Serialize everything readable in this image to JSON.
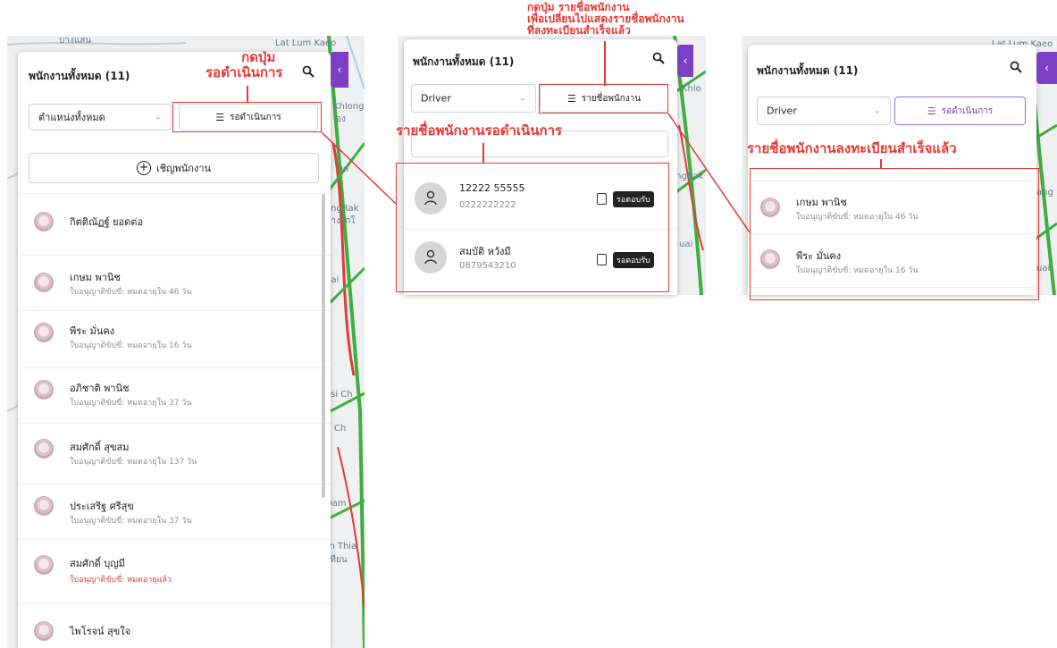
{
  "panels": {
    "left": {
      "title": "พนักงานทั้งหมด (11)",
      "position_select": "ตำแหน่งทั้งหมด",
      "pending_button": "รอดำเนินการ",
      "invite_button": "เชิญพนักงาน",
      "employees": [
        {
          "name": "กิตติณัฏฐ์ ยอดต่อ",
          "sub": "",
          "expired": false
        },
        {
          "name": "เกษม พานิช",
          "sub": "ใบอนุญาติขับขี่: หมดอายุใน 46 วัน",
          "expired": false
        },
        {
          "name": "พีระ มั่นคง",
          "sub": "ใบอนุญาติขับขี่: หมดอายุใน 16 วัน",
          "expired": false
        },
        {
          "name": "อภิชาติ พานิช",
          "sub": "ใบอนุญาติขับขี่: หมดอายุใน 37 วัน",
          "expired": false
        },
        {
          "name": "สมศักดิ์ สุขสม",
          "sub": "ใบอนุญาติขับขี่: หมดอายุใน 137 วัน",
          "expired": false
        },
        {
          "name": "ประเสริฐ ศรีสุข",
          "sub": "ใบอนุญาติขับขี่: หมดอายุใน 37 วัน",
          "expired": false
        },
        {
          "name": "สมศักดิ์ บุญมี",
          "sub": "ใบอนุญาติขับขี่: หมดอายุแล้ว",
          "expired": true
        },
        {
          "name": "ไพโรจน์ สุขใจ",
          "sub": "",
          "expired": false
        }
      ]
    },
    "middle": {
      "title": "พนักงานทั้งหมด (11)",
      "position_select": "Driver",
      "list_button": "รายชื่อพนักงาน",
      "pending": [
        {
          "name": "12222 55555",
          "phone": "0222222222",
          "badge": "รอตอบรับ"
        },
        {
          "name": "สมบัติ หวังมี",
          "phone": "0879543210",
          "badge": "รอตอบรับ"
        }
      ]
    },
    "right": {
      "title": "พนักงานทั้งหมด (11)",
      "position_select": "Driver",
      "pending_button": "รอดำเนินการ",
      "employees": [
        {
          "name": "เกษม พานิช",
          "sub": "ใบอนุญาติขับขี่: หมดอายุใน 46 วัน"
        },
        {
          "name": "พีระ มั่นคง",
          "sub": "ใบอนุญาติขับขี่: หมดอายุใน 16 วัน"
        }
      ]
    }
  },
  "annotations": {
    "a1_line1": "กดปุ่ม",
    "a1_line2": "รอดำเนินการ",
    "a2_line1": "กดปุ่ม รายชื่อพนักงาน",
    "a2_line2": "เพื่อเปลี่ยนไปแสดงรายชื่อพนักงาน",
    "a2_line3": "ที่ลงทะเบียนสำเร็จแล้ว",
    "a3": "รายชื่อพนักงานรอดำเนินการ",
    "a4": "รายชื่อพนักงานลงทะเบียนสำเร็จแล้ว"
  },
  "map_labels": {
    "l1": "บางแสน",
    "l2": "Lat Lum Kaeo",
    "l3": "Khlong",
    "l4": "อง",
    "l5": "On",
    "l6": "angRak",
    "l7": "บางรักใ",
    "l8": "uai",
    "l9": "asi Ch",
    "l10": "Ch",
    "l11": "Dam",
    "l12": "un Thia",
    "l13": "เทียน",
    "l14": "Lat Lum Kaeo",
    "l15": "Khlo",
    "l16": "angRak",
    "l17": "uai",
    "l18": "ang",
    "l19": "uai"
  },
  "colors": {
    "accent": "#7b3fc4",
    "annotation": "#e53935",
    "traffic_green": "#3fae3f",
    "traffic_red": "#e53935"
  }
}
